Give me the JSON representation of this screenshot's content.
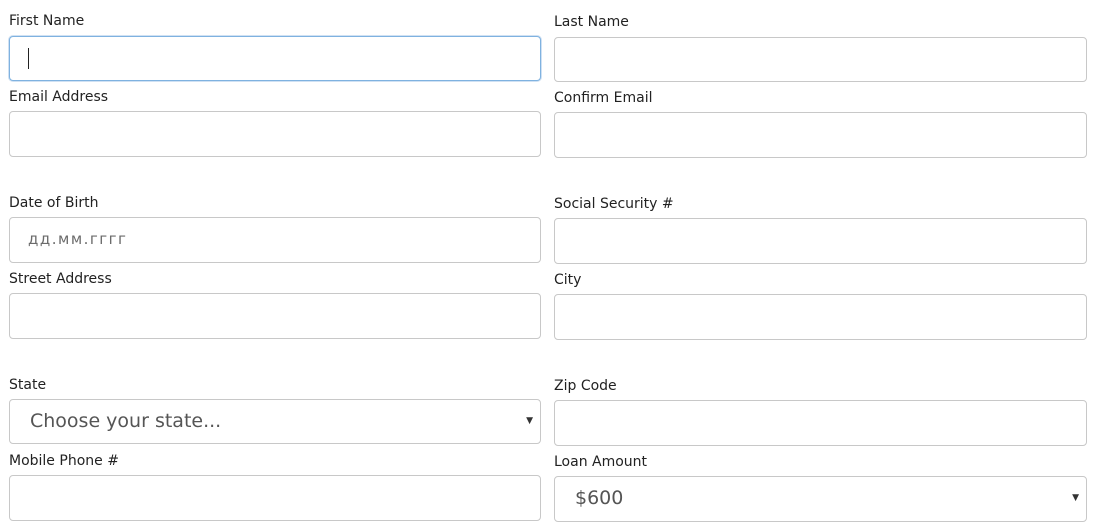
{
  "form": {
    "first_name": {
      "label": "First Name",
      "value": ""
    },
    "last_name": {
      "label": "Last Name",
      "value": ""
    },
    "email": {
      "label": "Email Address",
      "value": ""
    },
    "confirm_email": {
      "label": "Confirm Email",
      "value": ""
    },
    "dob": {
      "label": "Date of Birth",
      "placeholder": "дд.мм.гггг"
    },
    "ssn": {
      "label": "Social Security #",
      "value": ""
    },
    "street": {
      "label": "Street Address",
      "value": ""
    },
    "city": {
      "label": "City",
      "value": ""
    },
    "state": {
      "label": "State",
      "selected": "Choose your state..."
    },
    "zip": {
      "label": "Zip Code",
      "value": ""
    },
    "mobile": {
      "label": "Mobile Phone #",
      "value": ""
    },
    "loan_amount": {
      "label": "Loan Amount",
      "selected": "$600"
    }
  },
  "icons": {
    "dropdown": "chevron-down-icon",
    "dropdown_glyph": "▼"
  },
  "colors": {
    "focus_border": "#7fb2e0",
    "input_border": "#c8c8c8",
    "label_text": "#222222"
  }
}
